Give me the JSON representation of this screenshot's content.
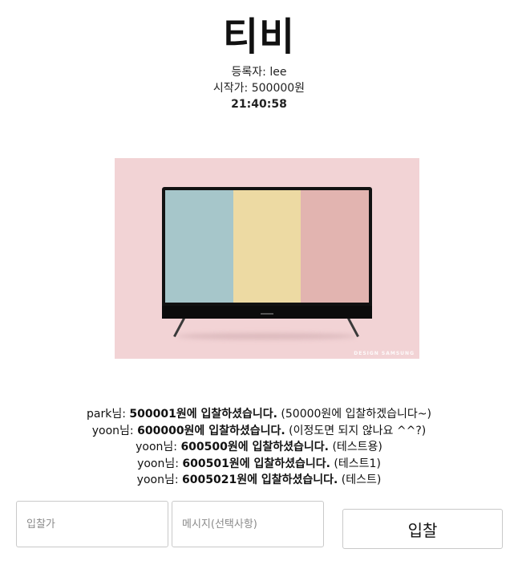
{
  "product": {
    "title": "티비",
    "seller_label": "등록자: lee",
    "start_price_label": "시작가: 500000원",
    "time_remaining": "21:40:58",
    "image": {
      "watermark": "DESIGN SAMSUNG",
      "background_color": "#f2d3d5",
      "screen_colors": [
        "#a6c6ca",
        "#eddaa3",
        "#e2b4b0"
      ]
    }
  },
  "bids": [
    {
      "user": "park님: ",
      "amount": "500001원에 입찰하셨습니다.",
      "message": " (50000원에 입찰하겠습니다~)"
    },
    {
      "user": "yoon님: ",
      "amount": "600000원에 입찰하셨습니다.",
      "message": " (이정도면 되지 않나요 ^^?)"
    },
    {
      "user": "yoon님: ",
      "amount": "600500원에 입찰하셨습니다.",
      "message": " (테스트용)"
    },
    {
      "user": "yoon님: ",
      "amount": "600501원에 입찰하셨습니다.",
      "message": " (테스트1)"
    },
    {
      "user": "yoon님: ",
      "amount": "6005021원에 입찰하셨습니다.",
      "message": " (테스트)"
    }
  ],
  "form": {
    "bid_placeholder": "입찰가",
    "message_placeholder": "메시지(선택사항)",
    "submit_label": "입찰"
  }
}
